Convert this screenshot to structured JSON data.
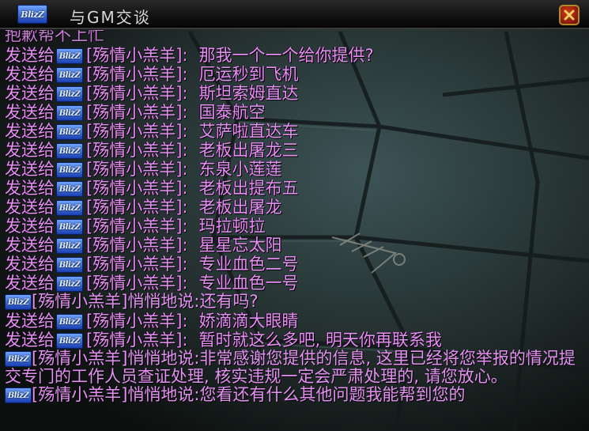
{
  "window": {
    "title": "与GM交谈",
    "icon_text": "BlizZ",
    "close_label": "✕"
  },
  "chat": {
    "top_partial": "抱歉帮不上忙",
    "sent_prefix": "发送给",
    "recipient": "[殇情小羔羊]:",
    "whisper_prefix": "[殇情小羔羊]悄悄地说:",
    "lines": [
      {
        "type": "sent",
        "message": "那我一个一个给你提供?"
      },
      {
        "type": "sent",
        "message": "厄运秒到飞机"
      },
      {
        "type": "sent",
        "message": "斯坦索姆直达"
      },
      {
        "type": "sent",
        "message": "国泰航空"
      },
      {
        "type": "sent",
        "message": "艾萨啦直达车"
      },
      {
        "type": "sent",
        "message": "老板出屠龙三"
      },
      {
        "type": "sent",
        "message": "东泉小莲莲"
      },
      {
        "type": "sent",
        "message": "老板出提布五"
      },
      {
        "type": "sent",
        "message": "老板出屠龙"
      },
      {
        "type": "sent",
        "message": "玛拉顿拉"
      },
      {
        "type": "sent",
        "message": "星星忘太阳"
      },
      {
        "type": "sent",
        "message": "专业血色二号"
      },
      {
        "type": "sent",
        "message": "专业血色一号"
      },
      {
        "type": "whisper",
        "message": "还有吗?"
      },
      {
        "type": "sent",
        "message": "娇滴滴大眼睛"
      },
      {
        "type": "sent",
        "message": "暂时就这么多吧, 明天你再联系我"
      },
      {
        "type": "whisper",
        "message": "非常感谢您提供的信息, 这里已经将您举报的情况提交专门的工作人员查证处理, 核实违规一定会严肃处理的, 请您放心。"
      },
      {
        "type": "whisper",
        "message": "您看还有什么其他问题我能帮到您的"
      }
    ]
  },
  "colors": {
    "chat_text": "#e590f2",
    "title_text": "#d8d8d8",
    "icon_blue": "#1a3fb0",
    "close_red": "#b52a10"
  }
}
